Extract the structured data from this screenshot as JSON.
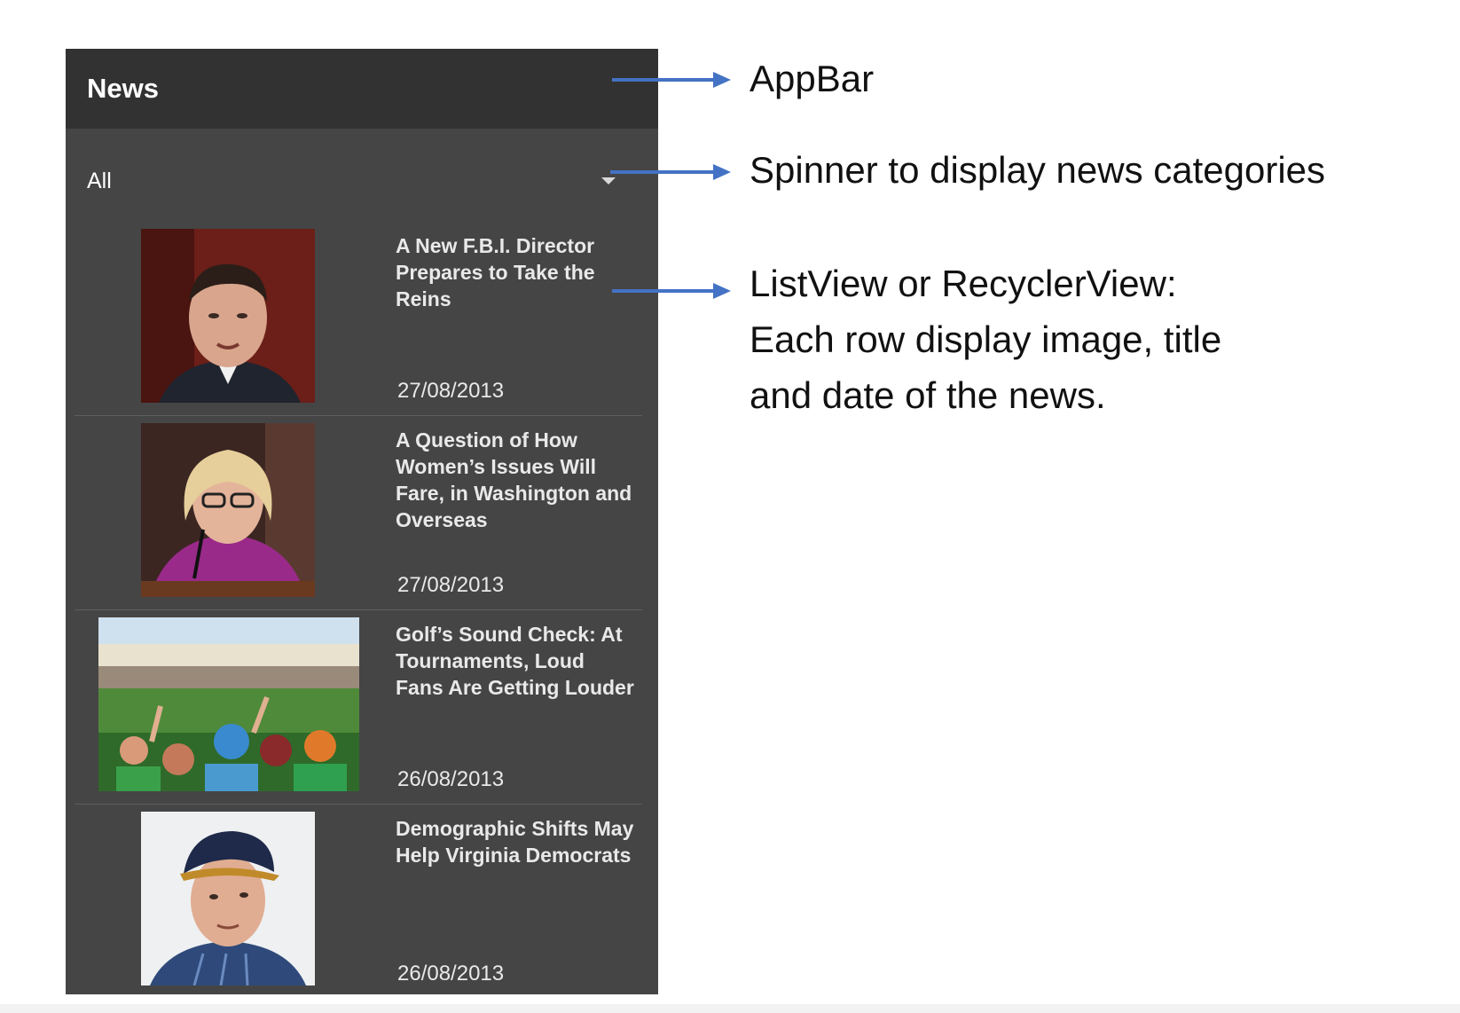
{
  "app": {
    "title": "News"
  },
  "spinner": {
    "value": "All"
  },
  "news": [
    {
      "title": "A New F.B.I. Director Prepares to Take the Reins",
      "date": "27/08/2013"
    },
    {
      "title": "A Question of How Women’s Issues Will Fare, in Washington and Overseas",
      "date": "27/08/2013"
    },
    {
      "title": "Golf’s Sound Check: At Tournaments, Loud Fans Are Getting Louder",
      "date": "26/08/2013"
    },
    {
      "title": "Demographic Shifts May Help Virginia Democrats",
      "date": "26/08/2013"
    }
  ],
  "annotations": {
    "appbar": "AppBar",
    "spinner": "Spinner to display news categories",
    "list_line1": "ListView or RecyclerView:",
    "list_line2": "Each row display image, title",
    "list_line3": "and date of the news."
  },
  "colors": {
    "appbar": "#323232",
    "body": "#454545",
    "arrow": "#4472c4"
  }
}
